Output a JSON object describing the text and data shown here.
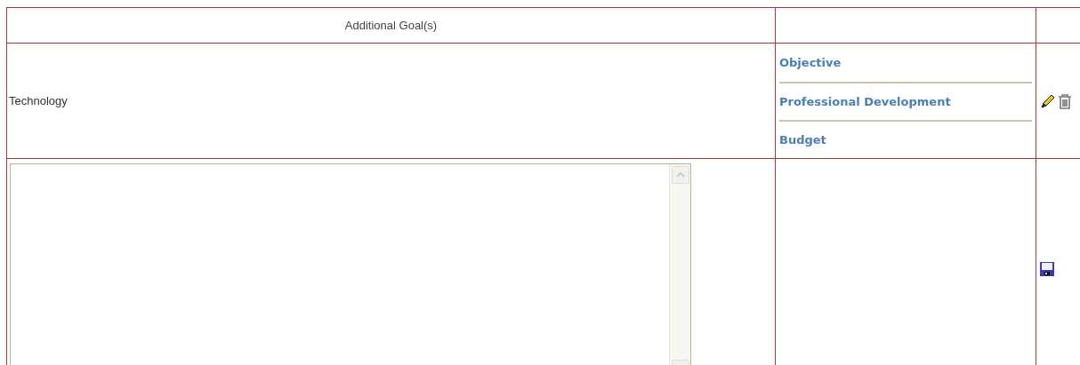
{
  "table": {
    "header": {
      "title": "Additional Goal(s)"
    },
    "goal_row": {
      "name": "Technology",
      "links": [
        "Objective",
        "Professional Development",
        "Budget"
      ]
    }
  }
}
